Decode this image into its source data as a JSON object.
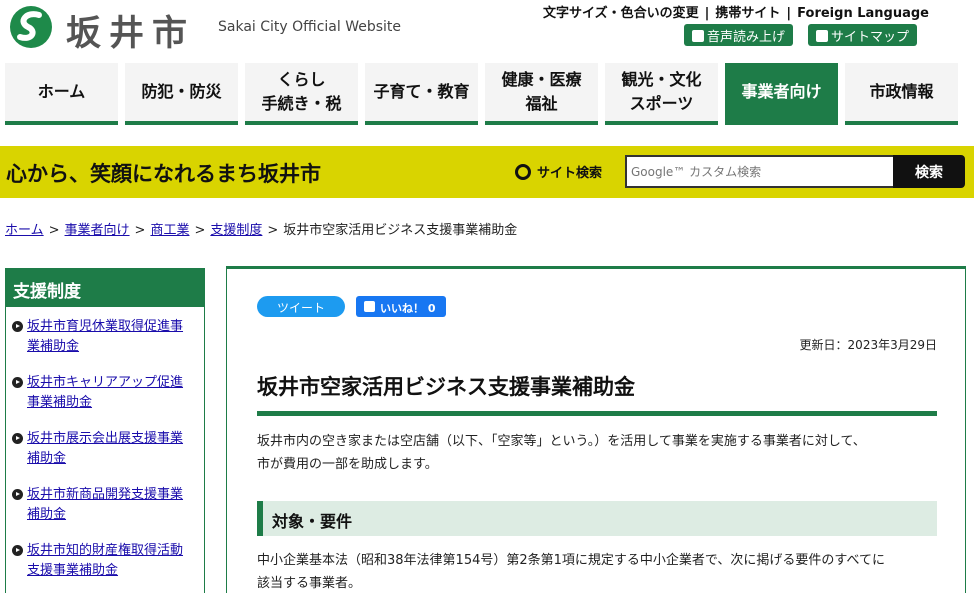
{
  "header": {
    "city_name": "坂井市",
    "city_sub": "Sakai City Official Website",
    "util_links": [
      "文字サイズ・色合いの変更",
      "携帯サイト",
      "Foreign Language"
    ],
    "voice_button": "音声読み上げ",
    "sitemap_button": "サイトマップ"
  },
  "nav": [
    {
      "label": "ホーム"
    },
    {
      "label": "防犯・防災"
    },
    {
      "label": "くらし\n手続き・税"
    },
    {
      "label": "子育て・教育"
    },
    {
      "label": "健康・医療\n福祉"
    },
    {
      "label": "観光・文化\nスポーツ"
    },
    {
      "label": "事業者向け",
      "active": true
    },
    {
      "label": "市政情報"
    }
  ],
  "band": {
    "tagline": "心から、笑顔になれるまち坂井市",
    "search_label": "サイト検索",
    "search_placeholder": "Google™ カスタム検索",
    "search_button": "検索"
  },
  "breadcrumb": [
    "ホーム",
    "事業者向け",
    "商工業",
    "支援制度",
    "坂井市空家活用ビジネス支援事業補助金"
  ],
  "sidebar": {
    "title": "支援制度",
    "items": [
      {
        "line1": "坂井市育児休業取得促進事",
        "line2": "業補助金"
      },
      {
        "line1": "坂井市キャリアアップ促進",
        "line2": "事業補助金"
      },
      {
        "line1": "坂井市展示会出展支援事業",
        "line2": "補助金"
      },
      {
        "line1": "坂井市新商品開発支援事業",
        "line2": "補助金"
      },
      {
        "line1": "坂井市知的財産権取得活動",
        "line2": "支援事業補助金"
      }
    ]
  },
  "main": {
    "tweet": "ツイート",
    "like": "いいね！ 0",
    "updated": "更新日：2023年3月29日",
    "title": "坂井市空家活用ビジネス支援事業補助金",
    "intro_line1": "坂井市内の空き家または空店舗（以下、「空家等」という。）を活用して事業を実施する事業者に対して、",
    "intro_line2": "市が費用の一部を助成します。",
    "section_heading": "対象・要件",
    "body_line1": "中小企業基本法（昭和38年法律第154号）第2条第1項に規定する中小企業者で、次に掲げる要件のすべてに",
    "body_line2": "該当する事業者。"
  },
  "colors": {
    "brand_green": "#1e7c48",
    "band_yellow": "#d9d400",
    "section_bg": "#ddece3"
  }
}
